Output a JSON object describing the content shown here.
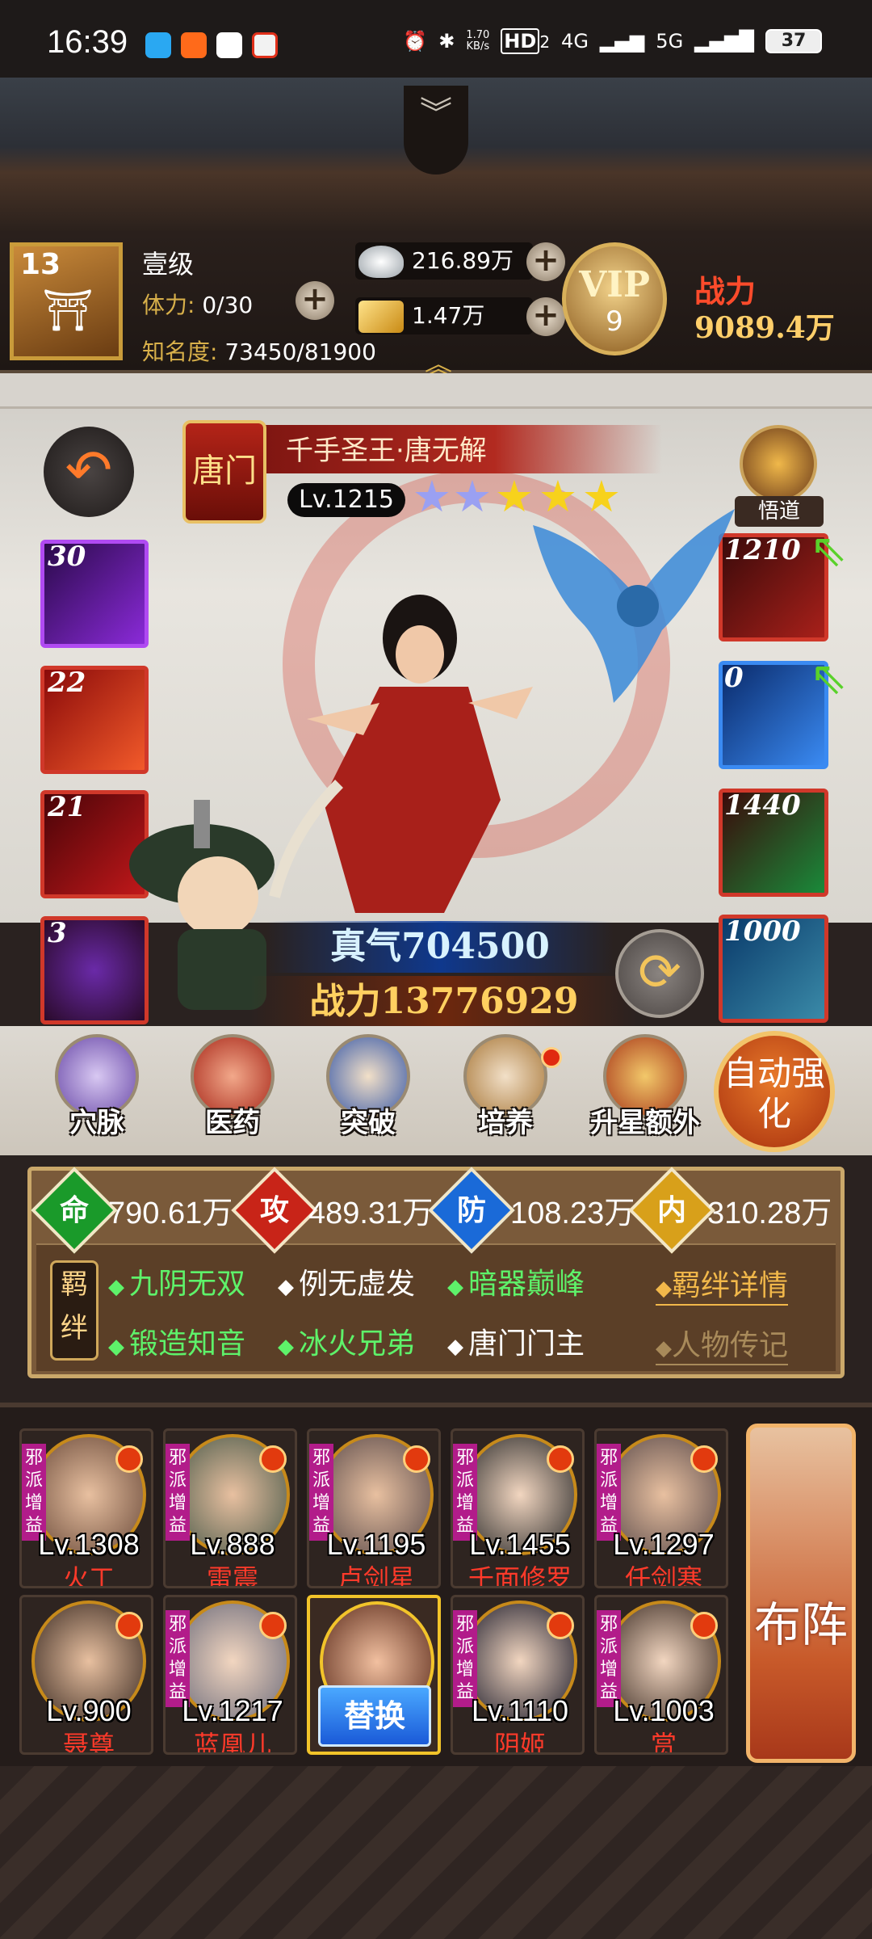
{
  "status_bar": {
    "time": "16:39",
    "net_speed_value": "1.70",
    "net_speed_unit": "KB/s",
    "hd_label": "HD",
    "hd_sub": "2",
    "signal_4g": "4G",
    "signal_5g": "5G",
    "battery": "37"
  },
  "player": {
    "level": "13",
    "title": "壹级",
    "stamina_label": "体力:",
    "stamina_value": "0/30",
    "fame_label": "知名度:",
    "fame_value": "73450/81900",
    "silver": "216.89万",
    "gold": "1.47万",
    "vip_label": "VIP",
    "vip_level": "9",
    "power_label": "战力",
    "power_value": "9089.4万"
  },
  "hero": {
    "seal_text": "唐门",
    "name": "千手圣王·唐无解",
    "level": "Lv.1215",
    "stars_purple": 2,
    "stars_gold": 3,
    "wudao_label": "悟道",
    "zhenqi_text": "真气704500",
    "power_text": "战力13776929"
  },
  "skills": [
    {
      "num": "30",
      "color": "#8a2ad8"
    },
    {
      "num": "22",
      "color": "#d8281a"
    },
    {
      "num": "21",
      "color": "#c0181a"
    },
    {
      "num": "3",
      "color": "#b0201a"
    }
  ],
  "equips": [
    {
      "num": "1210",
      "color": "#a8201a"
    },
    {
      "num": "0",
      "color": "#2a6ad8"
    },
    {
      "num": "1440",
      "color": "#a8201a"
    },
    {
      "num": "1000",
      "color": "#a8201a"
    }
  ],
  "menu": [
    {
      "label": "穴脉",
      "icon": "meridian-icon"
    },
    {
      "label": "医药",
      "icon": "medicine-icon"
    },
    {
      "label": "突破",
      "icon": "breakthrough-icon"
    },
    {
      "label": "培养",
      "icon": "scroll-icon"
    },
    {
      "label": "升星额外",
      "icon": "star-upgrade-icon"
    }
  ],
  "auto_enhance": "自动强化",
  "stats": [
    {
      "label": "命",
      "value": "790.61万",
      "color": "#1a9a2a"
    },
    {
      "label": "攻",
      "value": "489.31万",
      "color": "#c82418"
    },
    {
      "label": "防",
      "value": "108.23万",
      "color": "#1a6ad8"
    },
    {
      "label": "内",
      "value": "310.28万",
      "color": "#d8a01a"
    }
  ],
  "bonds_tag": "羁绊",
  "bonds": [
    {
      "text": "九阴无双",
      "active": true
    },
    {
      "text": "例无虚发",
      "active": false
    },
    {
      "text": "暗器巅峰",
      "active": true
    },
    {
      "text": "锻造知音",
      "active": true
    },
    {
      "text": "冰火兄弟",
      "active": true
    },
    {
      "text": "唐门门主",
      "active": false
    }
  ],
  "bond_links": {
    "details": "羁绊详情",
    "biography": "人物传记"
  },
  "lineup": [
    {
      "level": "Lv.1308",
      "name": "火工",
      "tag": "邪派增益"
    },
    {
      "level": "Lv.888",
      "name": "雷震",
      "tag": "邪派增益"
    },
    {
      "level": "Lv.1195",
      "name": "卢剑星",
      "tag": "邪派增益"
    },
    {
      "level": "Lv.1455",
      "name": "千面修罗",
      "tag": "邪派增益"
    },
    {
      "level": "Lv.1297",
      "name": "任剑寒",
      "tag": "邪派增益"
    },
    {
      "level": "Lv.900",
      "name": "聂尊",
      "tag": ""
    },
    {
      "level": "Lv.1217",
      "name": "蓝凰儿",
      "tag": "邪派增益"
    },
    {
      "level": "",
      "name": "",
      "tag": ""
    },
    {
      "level": "Lv.1110",
      "name": "阴姬",
      "tag": "邪派增益"
    },
    {
      "level": "Lv.1003",
      "name": "赏",
      "tag": "邪派增益"
    }
  ],
  "swap_label": "替换",
  "formation_label": "布阵",
  "colors": {
    "accent_gold": "#d8b04a",
    "bond_active": "#5ef26a",
    "hero_name_red": "#ff3a2a"
  }
}
